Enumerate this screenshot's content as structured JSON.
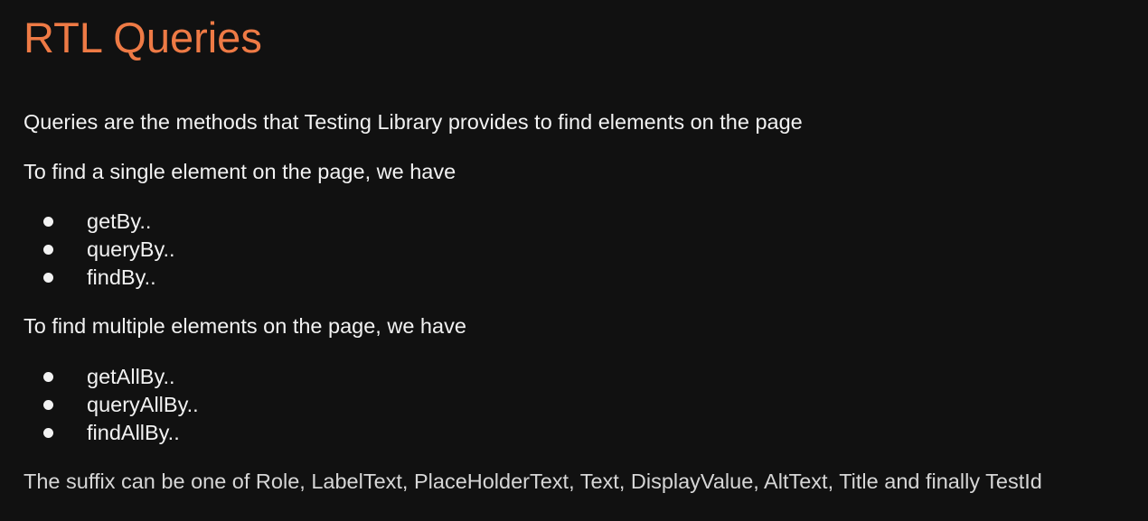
{
  "colors": {
    "background": "#111111",
    "title": "#ee7a45",
    "text": "#f2f2f2",
    "muted_text": "#d6d6d6"
  },
  "slide": {
    "title": "RTL Queries",
    "intro": "Queries are the methods that Testing Library provides to find elements on the page",
    "single_heading": "To find a single element on the page, we have",
    "single_items": [
      "getBy..",
      "queryBy..",
      "findBy.."
    ],
    "multiple_heading": "To find multiple elements on the page, we have",
    "multiple_items": [
      "getAllBy..",
      "queryAllBy..",
      "findAllBy.."
    ],
    "suffix_note": "The suffix can be one of Role, LabelText, PlaceHolderText, Text, DisplayValue, AltText, Title and finally TestId"
  }
}
